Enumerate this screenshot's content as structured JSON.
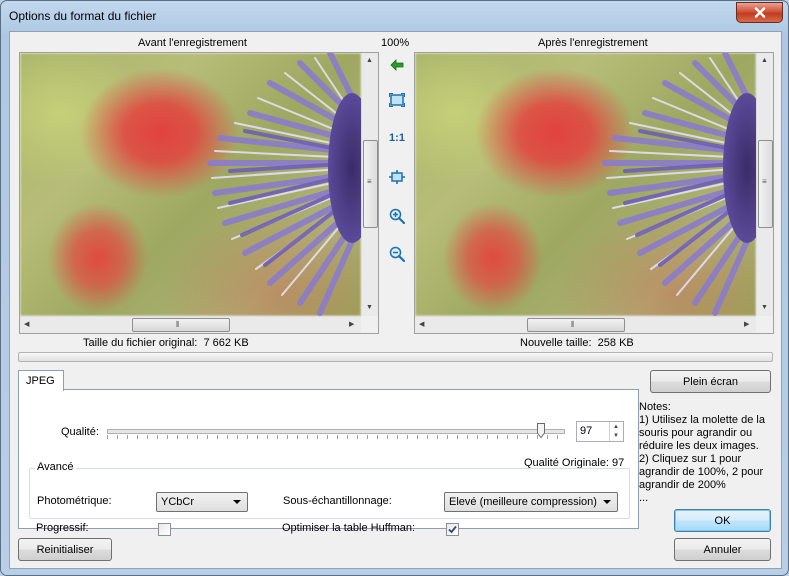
{
  "window": {
    "title": "Options du format du fichier",
    "close_icon": "close-icon"
  },
  "preview": {
    "before_label": "Avant l'enregistrement",
    "after_label": "Après l'enregistrement",
    "zoom": "100%",
    "original_size_label": "Taille du fichier original:",
    "original_size_value": "7 662 KB",
    "new_size_label": "Nouvelle taille:",
    "new_size_value": "258 KB"
  },
  "tools": {
    "sync": "green-arrow-icon",
    "fit": "fit-window-icon",
    "actual_size": "1:1",
    "fit_width": "fit-width-icon",
    "zoom_in": "zoom-in-icon",
    "zoom_out": "zoom-out-icon"
  },
  "tab": {
    "label": "JPEG"
  },
  "quality": {
    "label": "Qualité:",
    "value": "97",
    "slider_fraction": 0.97,
    "original_label": "Qualité Originale: 97"
  },
  "advanced": {
    "caption": "Avancé",
    "photometric_label": "Photométrique:",
    "photometric_value": "YCbCr",
    "subsampling_label": "Sous-échantillonnage:",
    "subsampling_value": "Elevé (meilleure compression)",
    "progressive_label": "Progressif:",
    "progressive_checked": false,
    "huffman_label": "Optimiser la table Huffman:",
    "huffman_checked": true
  },
  "buttons": {
    "fullscreen": "Plein écran",
    "ok": "OK",
    "cancel": "Annuler",
    "reset": "Reinitialiser"
  },
  "notes": "Notes:\n1) Utilisez la molette de la souris pour agrandir ou réduire les deux images.\n2) Cliquez sur 1 pour agrandir de 100%, 2 pour agrandir de 200%\n..."
}
